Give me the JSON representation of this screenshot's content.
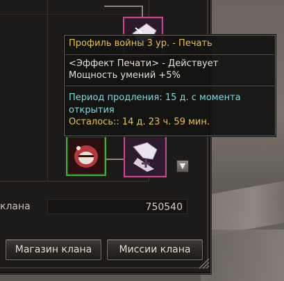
{
  "stat": {
    "label": "клана",
    "value": "750540"
  },
  "buttons": {
    "shop": "Магазин клана",
    "missions": "Миссии клана"
  },
  "tooltip": {
    "title": "Профиль войны 3 ур. - Печать",
    "effect_line1": "<Эффект Печати> - Действует",
    "effect_line2": "Мощность умений +5%",
    "period_line1": "Период продления: 15 д. с момента",
    "period_line2": "открытия",
    "remaining": "Осталось:: 14 д. 23 ч. 59 мин."
  },
  "icons": {
    "skill_top": "war-profile-seal-icon",
    "skill_green": "roaring-beast-skill-icon",
    "skill_pink": "seal-scroll-icon",
    "expand": "arrow-down-icon"
  },
  "colors": {
    "tooltip_title": "#e8c24a",
    "tooltip_info": "#7fd9df",
    "slot_pink": "#c04a8a",
    "slot_green": "#3fae3a"
  }
}
